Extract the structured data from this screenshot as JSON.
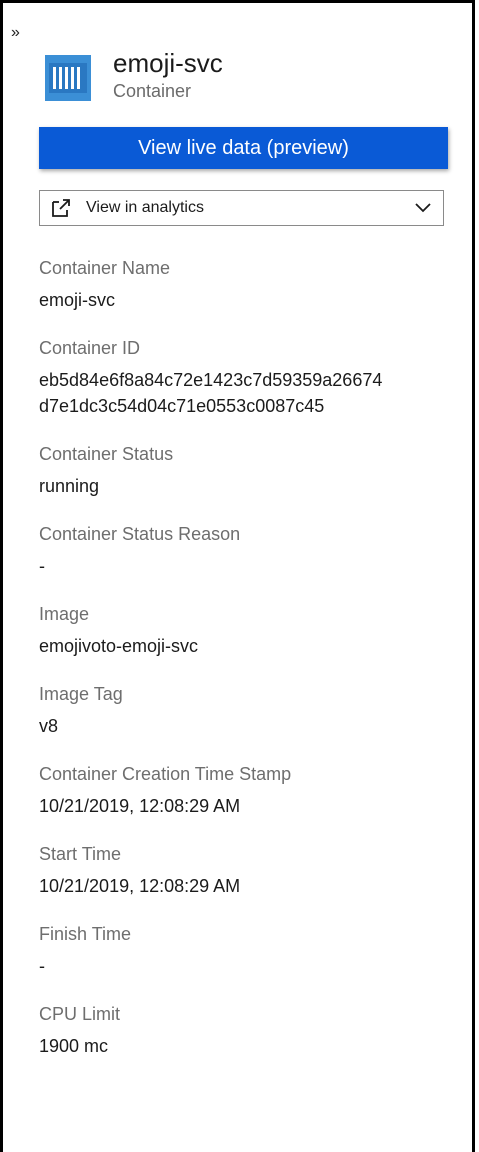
{
  "header": {
    "collapse_glyph": "»",
    "title": "emoji-svc",
    "subtitle": "Container",
    "icon": "container-icon"
  },
  "actions": {
    "live_data_label": "View live data (preview)",
    "analytics_label": "View in analytics"
  },
  "colors": {
    "accent": "#0a5ad6",
    "icon_blue": "#3b8fd6"
  },
  "properties": [
    {
      "label": "Container Name",
      "value": "emoji-svc"
    },
    {
      "label": "Container ID",
      "value_lines": [
        "eb5d84e6f8a84c72e1423c7d59359a26674",
        "d7e1dc3c54d04c71e0553c0087c45"
      ]
    },
    {
      "label": "Container Status",
      "value": "running"
    },
    {
      "label": "Container Status Reason",
      "value": "-"
    },
    {
      "label": "Image",
      "value": "emojivoto-emoji-svc"
    },
    {
      "label": "Image Tag",
      "value": "v8"
    },
    {
      "label": "Container Creation Time Stamp",
      "value": "10/21/2019, 12:08:29 AM"
    },
    {
      "label": "Start Time",
      "value": "10/21/2019, 12:08:29 AM"
    },
    {
      "label": "Finish Time",
      "value": "-"
    },
    {
      "label": "CPU Limit",
      "value": "1900 mc"
    }
  ]
}
